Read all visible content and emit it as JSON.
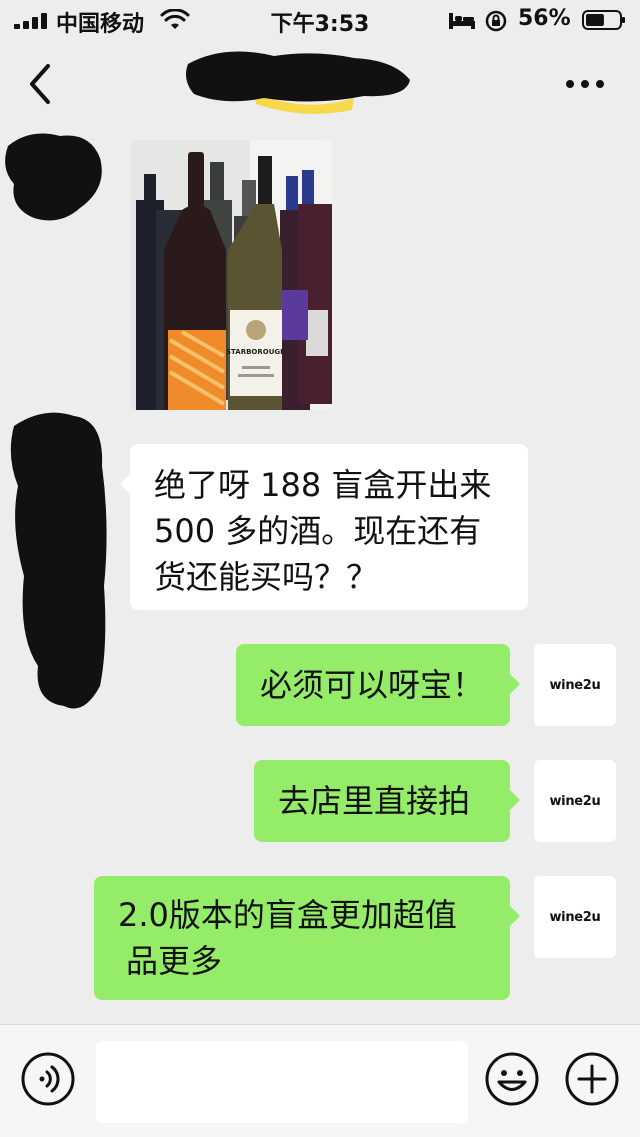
{
  "status_bar": {
    "carrier": "中国移动",
    "time": "下午3:53",
    "battery_percent": "56%",
    "battery_level": 0.56
  },
  "nav": {
    "back_icon": "chevron-left-icon",
    "more_icon": "more-dots-icon"
  },
  "messages": [
    {
      "side": "left",
      "type": "image",
      "description_icon": "photo"
    },
    {
      "side": "left",
      "type": "text",
      "lines": [
        "绝了呀 188 盲盒开出来",
        "500 多的酒。现在还有",
        "货还能买吗？？"
      ]
    },
    {
      "side": "right",
      "type": "text",
      "text": "必须可以呀宝！",
      "avatar": "wine2u"
    },
    {
      "side": "right",
      "type": "text",
      "text": "去店里直接拍",
      "avatar": "wine2u"
    },
    {
      "side": "right",
      "type": "text",
      "lines": [
        "2.0版本的盲盒更加超值",
        "品更多"
      ],
      "avatar": "wine2u"
    }
  ],
  "photo_labels": {
    "label_brand": "STARBOROUGH"
  },
  "input_bar": {
    "placeholder": "",
    "voice_icon": "voice-icon",
    "emoji_icon": "emoji-icon",
    "plus_icon": "plus-icon"
  },
  "colors": {
    "background": "#ededed",
    "bubble_left": "#ffffff",
    "bubble_right": "#95ec69"
  }
}
